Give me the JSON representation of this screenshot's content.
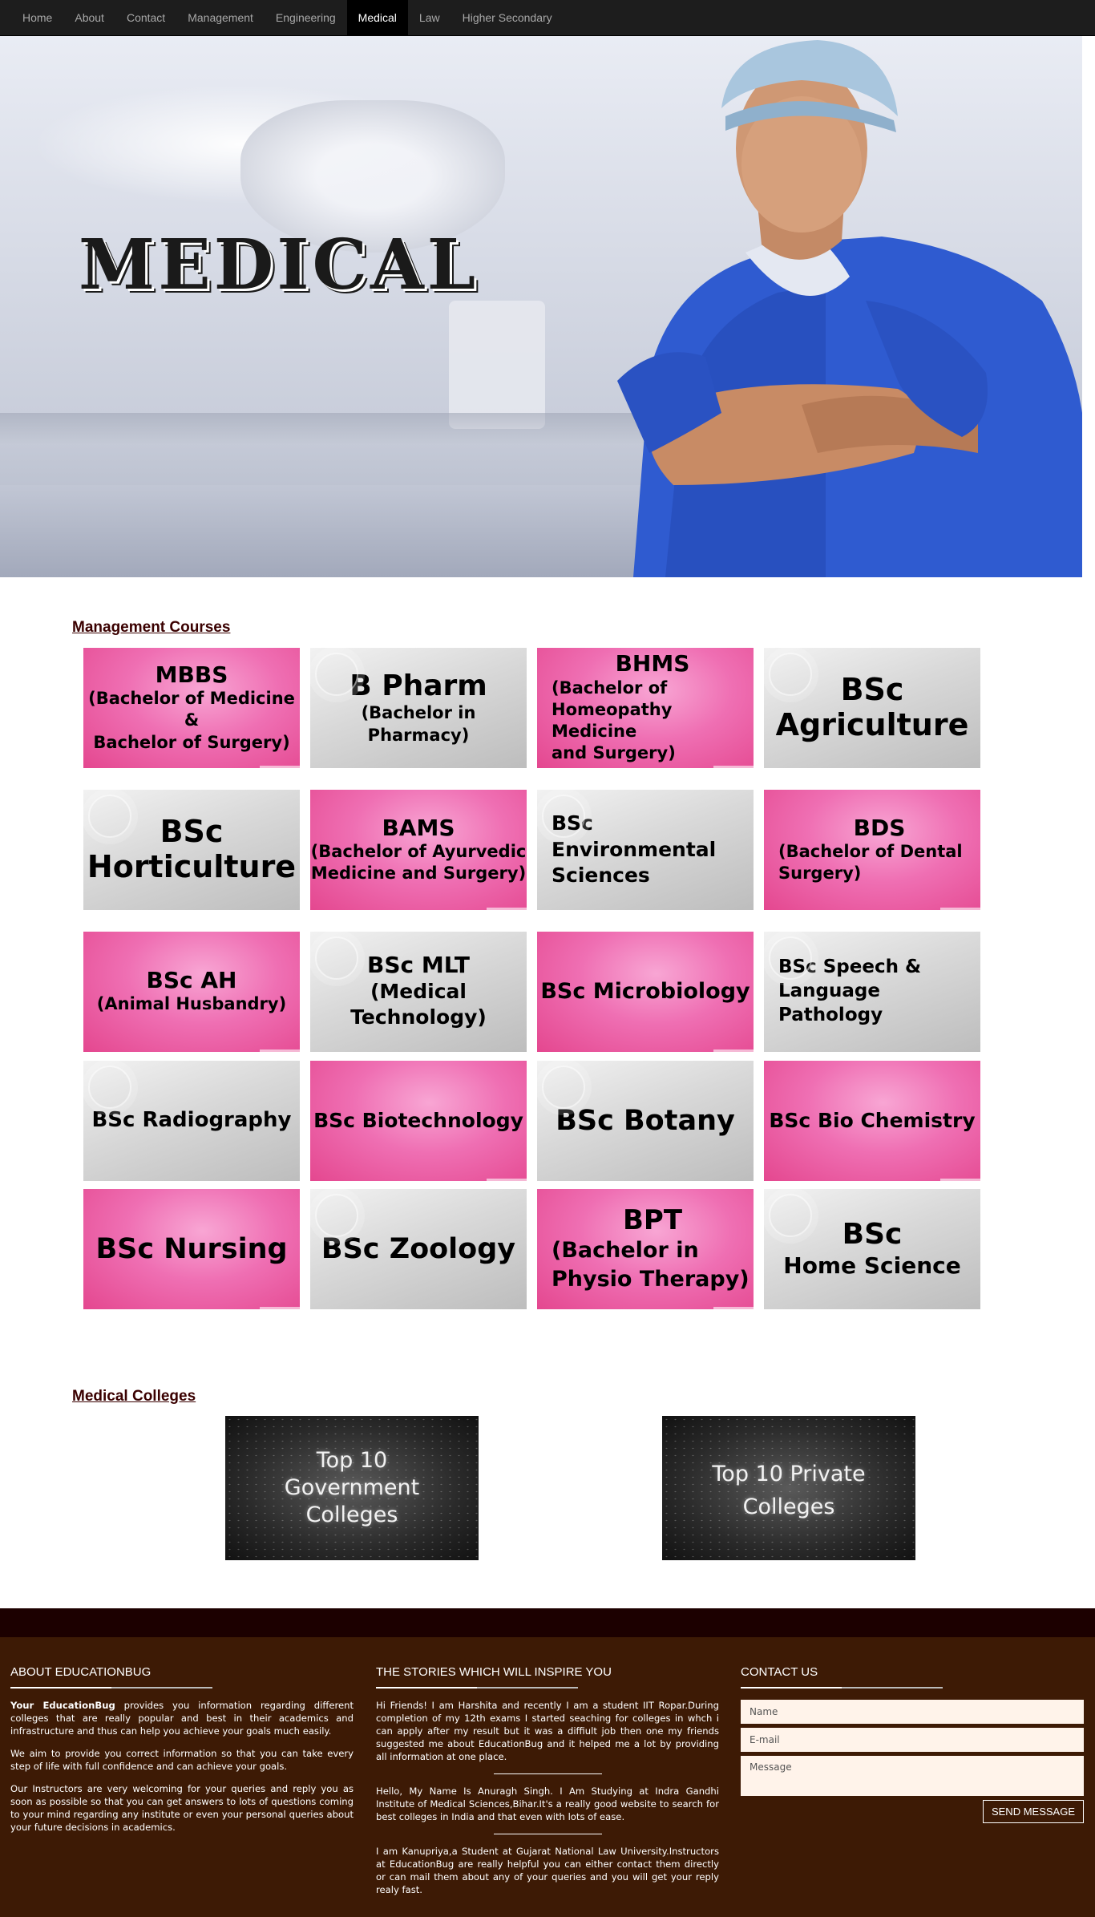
{
  "nav": {
    "items": [
      "Home",
      "About",
      "Contact",
      "Management",
      "Engineering",
      "Medical",
      "Law",
      "Higher Secondary"
    ],
    "active": "Medical"
  },
  "hero": {
    "title": "MEDICAL"
  },
  "courses_section": {
    "heading": "Management Courses",
    "cards": [
      {
        "lines": [
          "MBBS",
          "(Bachelor of Medicine &",
          "Bachelor of Surgery)"
        ],
        "color": "pink"
      },
      {
        "lines": [
          "B Pharm",
          "(Bachelor in Pharmacy)"
        ],
        "color": "gray"
      },
      {
        "lines": [
          "BHMS",
          "(Bachelor of",
          "Homeopathy Medicine",
          "and Surgery)"
        ],
        "color": "pink"
      },
      {
        "lines": [
          "BSc",
          "Agriculture"
        ],
        "color": "gray"
      },
      {
        "lines": [
          "BSc",
          "Horticulture"
        ],
        "color": "gray"
      },
      {
        "lines": [
          "BAMS",
          "(Bachelor of Ayurvedic",
          "Medicine and Surgery)"
        ],
        "color": "pink"
      },
      {
        "lines": [
          "BSc",
          "Environmental",
          "Sciences"
        ],
        "color": "gray"
      },
      {
        "lines": [
          "BDS",
          "(Bachelor of Dental",
          "Surgery)"
        ],
        "color": "pink"
      },
      {
        "lines": [
          "BSc AH",
          "(Animal Husbandry)"
        ],
        "color": "pink"
      },
      {
        "lines": [
          "BSc MLT",
          "(Medical Technology)"
        ],
        "color": "gray"
      },
      {
        "lines": [
          "BSc Microbiology"
        ],
        "color": "pink"
      },
      {
        "lines": [
          "BSc Speech &",
          "Language Pathology"
        ],
        "color": "gray"
      },
      {
        "lines": [
          "BSc Radiography"
        ],
        "color": "gray"
      },
      {
        "lines": [
          "BSc Biotechnology"
        ],
        "color": "pink"
      },
      {
        "lines": [
          "BSc Botany"
        ],
        "color": "gray"
      },
      {
        "lines": [
          "BSc Bio Chemistry"
        ],
        "color": "pink"
      },
      {
        "lines": [
          "BSc Nursing"
        ],
        "color": "pink"
      },
      {
        "lines": [
          "BSc Zoology"
        ],
        "color": "gray"
      },
      {
        "lines": [
          "BPT",
          "(Bachelor in",
          "Physio Therapy)"
        ],
        "color": "pink"
      },
      {
        "lines": [
          "BSc",
          "Home Science"
        ],
        "color": "gray"
      }
    ]
  },
  "colleges_section": {
    "heading": "Medical Colleges",
    "cards": [
      {
        "lines": [
          "Top 10",
          "Government",
          "Colleges"
        ]
      },
      {
        "lines": [
          "Top 10 Private",
          "Colleges"
        ]
      }
    ]
  },
  "footer": {
    "about": {
      "heading": "ABOUT EDUCATIONBUG",
      "brand": "Your EducationBug",
      "p1_rest": " provides you information regarding different colleges that are really popular and best in their academics and infrastructure and thus can help you achieve your goals much easily.",
      "p2": "We aim to provide you correct information so that you can take every step of life with full confidence and can achieve your goals.",
      "p3": "Our Instructors are very welcoming for your queries and reply you as soon as possible so that you can get answers to lots of questions coming to your mind regarding any institute or even your personal queries about your future decisions in academics."
    },
    "stories": {
      "heading": "THE STORIES WHICH WILL INSPIRE YOU",
      "items": [
        "Hi Friends! I am Harshita and recently I am a student IIT Ropar.During completion of my 12th exams I started seaching for colleges in whch i can apply after my result but it was a diffiult job then one my friends suggested me about EducationBug and it helped me a lot by providing all information at one place.",
        "Hello, My Name Is Anuragh Singh. I Am Studying at Indra Gandhi Institute of Medical Sciences,Bihar.It's a really good website to search for best colleges in India and that even with lots of ease.",
        "I am Kanupriya,a Student at Gujarat National Law University.Instructors at EducationBug are really helpful you can either contact them directly or can mail them about any of your queries and you will get your reply realy fast."
      ]
    },
    "contact": {
      "heading": "CONTACT US",
      "name_placeholder": "Name",
      "email_placeholder": "E-mail",
      "message_placeholder": "Message",
      "send_label": "SEND MESSAGE"
    }
  },
  "colors": {
    "nav_bg": "#1d1d1d",
    "accent_pink": "#ef6fb3",
    "footer_bg": "#3d1a05",
    "footer_band": "#1c0000",
    "heading_text": "#3a0000"
  }
}
